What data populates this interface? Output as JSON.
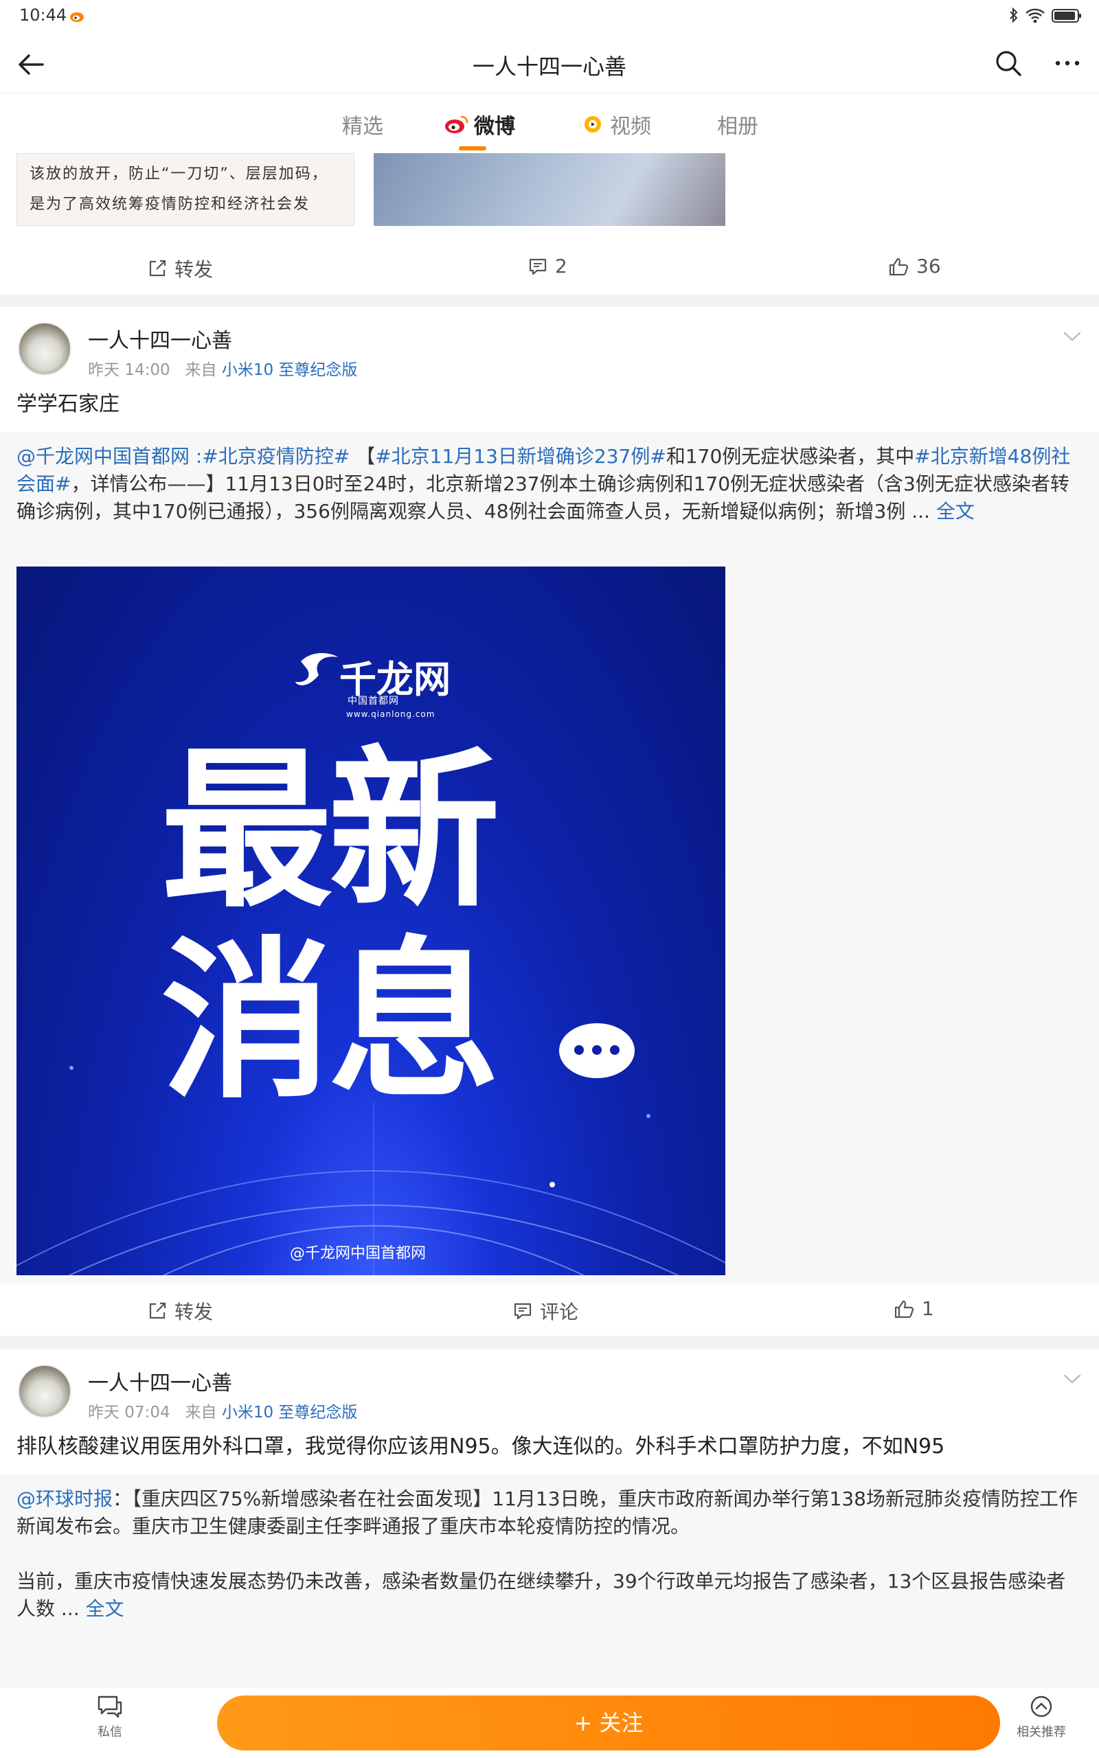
{
  "status_bar": {
    "time": "10:44"
  },
  "header": {
    "title": "一人十四一心善"
  },
  "tabs": [
    {
      "label": "精选",
      "active": false
    },
    {
      "label": "微博",
      "active": true
    },
    {
      "label": "视频",
      "active": false
    },
    {
      "label": "相册",
      "active": false
    }
  ],
  "top_post": {
    "image_text": "该放的放开，防止“一刀切”、层层加码，是为了高效统筹疫情防控和经济社会发展，最大程度保护人民生命安全和",
    "actions": {
      "repost": "转发",
      "comments": "2",
      "likes": "36"
    }
  },
  "posts": [
    {
      "username": "一人十四一心善",
      "time": "昨天 14:00",
      "source_prefix": "来自",
      "source": "小米10 至尊纪念版",
      "text": "学学石家庄",
      "repost": {
        "mention": "@千龙网中国首都网",
        "sep": " :",
        "topic1": "#北京疫情防控#",
        "mid1": " 【",
        "topic2": "#北京11月13日新增确诊237例#",
        "mid2": "和170例无症状感染者，其中",
        "topic3": "#北京新增48例社会面#",
        "body": "，详情公布——】11月13日0时至24时，北京新增237例本土确诊病例和170例无症状感染者（含3例无症状感染者转确诊病例，其中170例已通报），356例隔离观察人员、48例社会面筛查人员，无新增疑似病例；新增3例 ... ",
        "full": "全文"
      },
      "image": {
        "logo": "千龙网",
        "logo_sub": "中国首都网",
        "logo_url": "www.qianlong.com",
        "line1": "最新",
        "line2": "消息",
        "watermark": "@千龙网中国首都网"
      },
      "actions": {
        "repost": "转发",
        "comment": "评论",
        "likes": "1"
      }
    },
    {
      "username": "一人十四一心善",
      "time": "昨天 07:04",
      "source_prefix": "来自",
      "source": "小米10 至尊纪念版",
      "text": "排队核酸建议用医用外科口罩，我觉得你应该用N95。像大连似的。外科手术口罩防护力度，不如N95",
      "repost": {
        "mention": "@环球时报",
        "body1": "：【重庆四区75%新增感染者在社会面发现】11月13日晚，重庆市政府新闻办举行第138场新冠肺炎疫情防控工作新闻发布会。重庆市卫生健康委副主任李畔通报了重庆市本轮疫情防控的情况。",
        "body2": "当前，重庆市疫情快速发展态势仍未改善，感染者数量仍在继续攀升，39个行政单元均报告了感染者，13个区县报告感染者人数 ... ",
        "full": "全文"
      }
    }
  ],
  "bottom_bar": {
    "message": "私信",
    "follow": "+ 关注",
    "related": "相关推荐"
  },
  "colors": {
    "accent": "#ff8200",
    "link": "#2a6dbc",
    "divider": "#f2f2f2"
  }
}
